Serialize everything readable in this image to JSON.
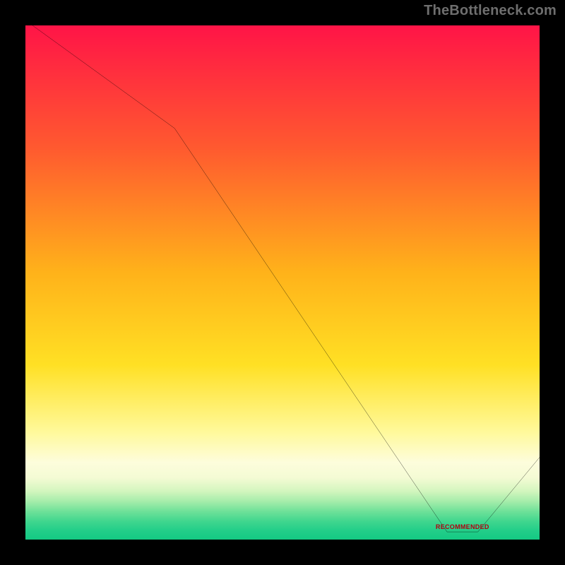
{
  "watermark": "TheBottleneck.com",
  "chart_data": {
    "type": "line",
    "title": "",
    "xlabel": "",
    "ylabel": "",
    "xlim": [
      0,
      100
    ],
    "ylim": [
      0,
      100
    ],
    "series": [
      {
        "name": "bottleneck-curve",
        "x": [
          0,
          29,
          82,
          88,
          100
        ],
        "values": [
          101,
          80,
          1.5,
          1.5,
          16
        ]
      }
    ],
    "background_gradient": {
      "stops": [
        {
          "pct": 0,
          "color": "#ff1447"
        },
        {
          "pct": 24,
          "color": "#ff5a2f"
        },
        {
          "pct": 48,
          "color": "#ffb21a"
        },
        {
          "pct": 66,
          "color": "#ffe024"
        },
        {
          "pct": 79,
          "color": "#fff99a"
        },
        {
          "pct": 85,
          "color": "#fdfddc"
        },
        {
          "pct": 88,
          "color": "#f4fbd4"
        },
        {
          "pct": 90.5,
          "color": "#d4f6bf"
        },
        {
          "pct": 92.5,
          "color": "#a7edab"
        },
        {
          "pct": 94.5,
          "color": "#6fe199"
        },
        {
          "pct": 96.5,
          "color": "#3fd68e"
        },
        {
          "pct": 98.2,
          "color": "#23ce89"
        },
        {
          "pct": 100,
          "color": "#14c983"
        }
      ]
    },
    "valley_label": {
      "text": "RECOMMENDED",
      "x": 85
    }
  }
}
